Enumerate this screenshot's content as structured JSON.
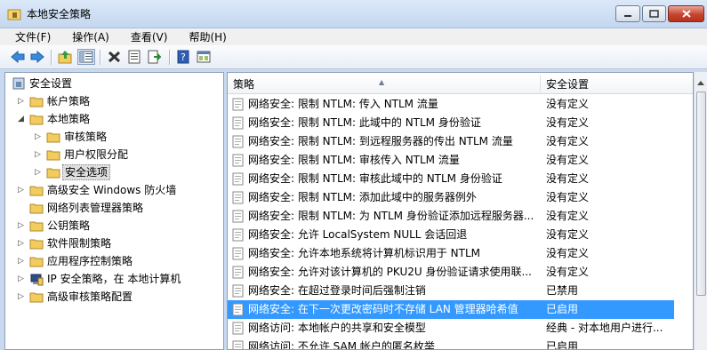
{
  "window": {
    "title": "本地安全策略",
    "buttons": {
      "minimize": "minimize",
      "maximize": "maximize",
      "close": "close"
    }
  },
  "menu": [
    {
      "label": "文件(F)"
    },
    {
      "label": "操作(A)"
    },
    {
      "label": "查看(V)"
    },
    {
      "label": "帮助(H)"
    }
  ],
  "toolbar": {
    "icons": [
      "back-icon",
      "forward-icon",
      "up-folder-icon",
      "show-tree-icon",
      "delete-icon",
      "properties-icon",
      "export-icon",
      "help-icon",
      "console-icon"
    ]
  },
  "tree": [
    {
      "label": "安全设置"
    },
    {
      "label": "帐户策略"
    },
    {
      "label": "本地策略"
    },
    {
      "label": "审核策略"
    },
    {
      "label": "用户权限分配"
    },
    {
      "label": "安全选项"
    },
    {
      "label": "高级安全 Windows 防火墙"
    },
    {
      "label": "网络列表管理器策略"
    },
    {
      "label": "公钥策略"
    },
    {
      "label": "软件限制策略"
    },
    {
      "label": "应用程序控制策略"
    },
    {
      "label": "IP 安全策略，在 本地计算机"
    },
    {
      "label": "高级审核策略配置"
    }
  ],
  "list": {
    "headers": {
      "policy": "策略",
      "setting": "安全设置"
    },
    "rows": [
      {
        "policy": "网络安全: 限制 NTLM: 传入 NTLM 流量",
        "setting": "没有定义"
      },
      {
        "policy": "网络安全: 限制 NTLM: 此域中的 NTLM 身份验证",
        "setting": "没有定义"
      },
      {
        "policy": "网络安全: 限制 NTLM: 到远程服务器的传出 NTLM 流量",
        "setting": "没有定义"
      },
      {
        "policy": "网络安全: 限制 NTLM: 审核传入 NTLM 流量",
        "setting": "没有定义"
      },
      {
        "policy": "网络安全: 限制 NTLM: 审核此域中的 NTLM 身份验证",
        "setting": "没有定义"
      },
      {
        "policy": "网络安全: 限制 NTLM: 添加此域中的服务器例外",
        "setting": "没有定义"
      },
      {
        "policy": "网络安全: 限制 NTLM: 为 NTLM 身份验证添加远程服务器...",
        "setting": "没有定义"
      },
      {
        "policy": "网络安全: 允许 LocalSystem NULL 会话回退",
        "setting": "没有定义"
      },
      {
        "policy": "网络安全: 允许本地系统将计算机标识用于 NTLM",
        "setting": "没有定义"
      },
      {
        "policy": "网络安全: 允许对该计算机的 PKU2U 身份验证请求使用联...",
        "setting": "没有定义"
      },
      {
        "policy": "网络安全: 在超过登录时间后强制注销",
        "setting": "已禁用"
      },
      {
        "policy": "网络安全: 在下一次更改密码时不存储 LAN 管理器哈希值",
        "setting": "已启用"
      },
      {
        "policy": "网络访问: 本地帐户的共享和安全模型",
        "setting": "经典 - 对本地用户进行..."
      },
      {
        "policy": "网络访问: 不允许 SAM 帐户的匿名枚举",
        "setting": "已启用"
      }
    ]
  }
}
